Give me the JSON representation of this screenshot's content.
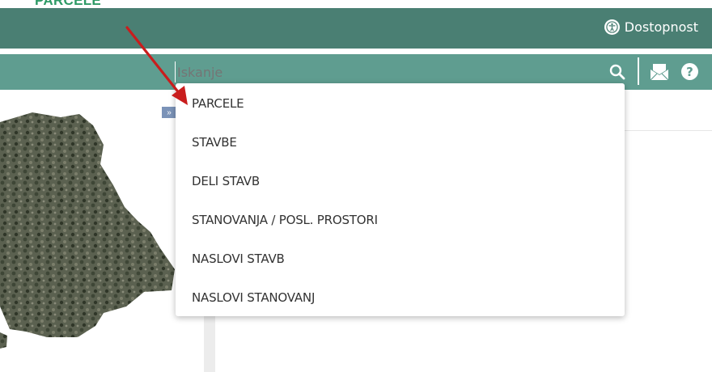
{
  "annotation": {
    "title": "PARCELE"
  },
  "header": {
    "accessibility_label": "Dostopnost",
    "accessibility_icon": "accessibility-icon"
  },
  "search": {
    "placeholder": "Iskanje",
    "search_icon": "search-icon",
    "mail_icon": "mail-icon",
    "help_icon": "help-icon",
    "help_glyph": "?"
  },
  "map": {
    "expand_glyph": "»"
  },
  "dropdown": {
    "items": [
      "PARCELE",
      "STAVBE",
      "DELI STAVB",
      "STANOVANJA / POSL. PROSTORI",
      "NASLOVI STAVB",
      "NASLOVI STANOVANJ"
    ]
  },
  "colors": {
    "header": "#4a7f73",
    "searchbar": "#5f9d90",
    "arrow": "#c91d1d",
    "title": "#2e9a66"
  }
}
